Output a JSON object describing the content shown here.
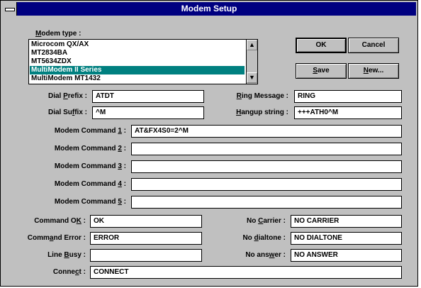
{
  "window": {
    "title": "Modem Setup"
  },
  "modem_type": {
    "label_pre": "",
    "label_key": "M",
    "label_post": "odem type :",
    "items": [
      "Microcom QX/AX",
      "MT2834BA",
      "MT5634ZDX",
      "MultiModem II Series",
      "MultiModem MT1432"
    ],
    "selected": "MultiModem II Series"
  },
  "buttons": {
    "ok": "OK",
    "cancel": "Cancel",
    "save_key": "S",
    "save_rest": "ave",
    "new_key": "N",
    "new_rest": "ew..."
  },
  "dial_prefix": {
    "pre": "Dial ",
    "key": "P",
    "post": "refix :",
    "value": "ATDT"
  },
  "dial_suffix": {
    "pre": "Dial Su",
    "key": "f",
    "post": "fix :",
    "value": "^M"
  },
  "ring_message": {
    "pre": "",
    "key": "R",
    "post": "ing Message :",
    "value": "RING"
  },
  "hangup_string": {
    "pre": "",
    "key": "H",
    "post": "angup string :",
    "value": "+++ATH0^M"
  },
  "commands": [
    {
      "pre": "Modem Command ",
      "key": "1",
      "post": " :",
      "value": "AT&FX4S0=2^M"
    },
    {
      "pre": "Modem Command ",
      "key": "2",
      "post": " :",
      "value": ""
    },
    {
      "pre": "Modem Command ",
      "key": "3",
      "post": " :",
      "value": ""
    },
    {
      "pre": "Modem Command ",
      "key": "4",
      "post": " :",
      "value": ""
    },
    {
      "pre": "Modem Command ",
      "key": "5",
      "post": " :",
      "value": ""
    }
  ],
  "command_ok": {
    "pre": "Command O",
    "key": "K",
    "post": " :",
    "value": "OK"
  },
  "command_error": {
    "pre": "Comm",
    "key": "a",
    "post": "nd Error :",
    "value": "ERROR"
  },
  "line_busy": {
    "pre": "Line ",
    "key": "B",
    "post": "usy :",
    "value": ""
  },
  "connect": {
    "pre": "Conne",
    "key": "c",
    "post": "t :",
    "value": "CONNECT"
  },
  "no_carrier": {
    "pre": "No ",
    "key": "C",
    "post": "arrier :",
    "value": "NO CARRIER"
  },
  "no_dialtone": {
    "pre": "No ",
    "key": "d",
    "post": "ialtone :",
    "value": "NO DIALTONE"
  },
  "no_answer": {
    "pre": "No ans",
    "key": "w",
    "post": "er :",
    "value": "NO ANSWER"
  }
}
